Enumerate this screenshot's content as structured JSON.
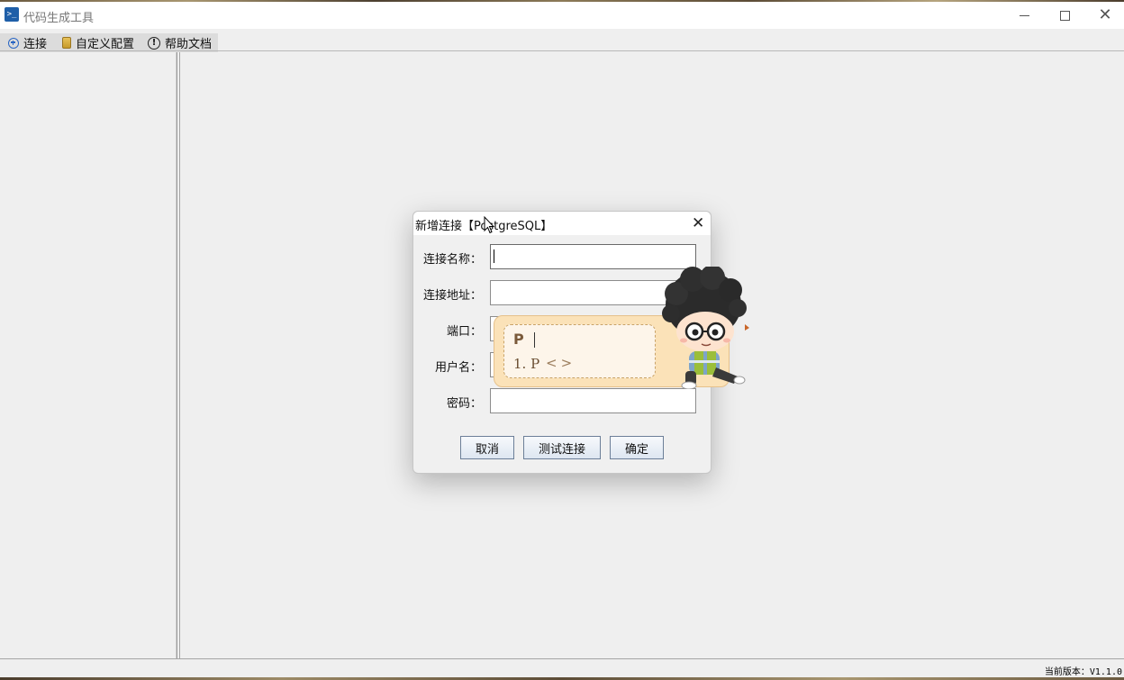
{
  "window": {
    "title": "代码生成工具",
    "icon": "terminal-icon",
    "controls": {
      "minimize": "minimize-icon",
      "maximize": "maximize-icon",
      "close": "close-icon"
    }
  },
  "menu": {
    "items": [
      {
        "label": "连接",
        "icon": "add-circle-icon"
      },
      {
        "label": "自定义配置",
        "icon": "config-icon"
      },
      {
        "label": "帮助文档",
        "icon": "info-icon"
      }
    ]
  },
  "dialog": {
    "title": "新增连接【PostgreSQL】",
    "fields": [
      {
        "label": "连接名称：",
        "value": ""
      },
      {
        "label": "连接地址：",
        "value": ""
      },
      {
        "label": "端口：",
        "value": ""
      },
      {
        "label": "用户名：",
        "value": ""
      },
      {
        "label": "密码：",
        "value": ""
      }
    ],
    "buttons": {
      "cancel": "取消",
      "test": "测试连接",
      "ok": "确定"
    }
  },
  "ime": {
    "composition": "P",
    "candidate": "1. P",
    "nav": "<>"
  },
  "status": {
    "version": "当前版本：V1.1.0"
  },
  "colors": {
    "accent": "#2a66c4",
    "ime_bg": "#fbe2b8"
  }
}
